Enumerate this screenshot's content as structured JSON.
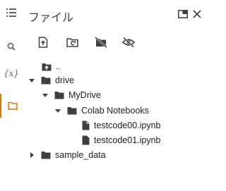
{
  "panel": {
    "title": "ファイル"
  },
  "rail": {
    "items": [
      {
        "name": "table-of-contents",
        "icon": "list-icon"
      },
      {
        "name": "search",
        "icon": "search-icon"
      },
      {
        "name": "variables",
        "icon": "variables-icon",
        "label": "{x}"
      },
      {
        "name": "files",
        "icon": "folder-icon",
        "active": true
      }
    ]
  },
  "toolbar": {
    "buttons": [
      "upload-file-icon",
      "refresh-icon",
      "unmount-drive-icon",
      "hide-files-icon"
    ]
  },
  "tree": {
    "parent": "..",
    "drive": "drive",
    "mydrive": "MyDrive",
    "colab": "Colab Notebooks",
    "file1": "testcode00.ipynb",
    "file2": "testcode01.ipynb",
    "sample": "sample_data"
  },
  "colors": {
    "accent": "#e37400",
    "icon": "#3c4043"
  }
}
